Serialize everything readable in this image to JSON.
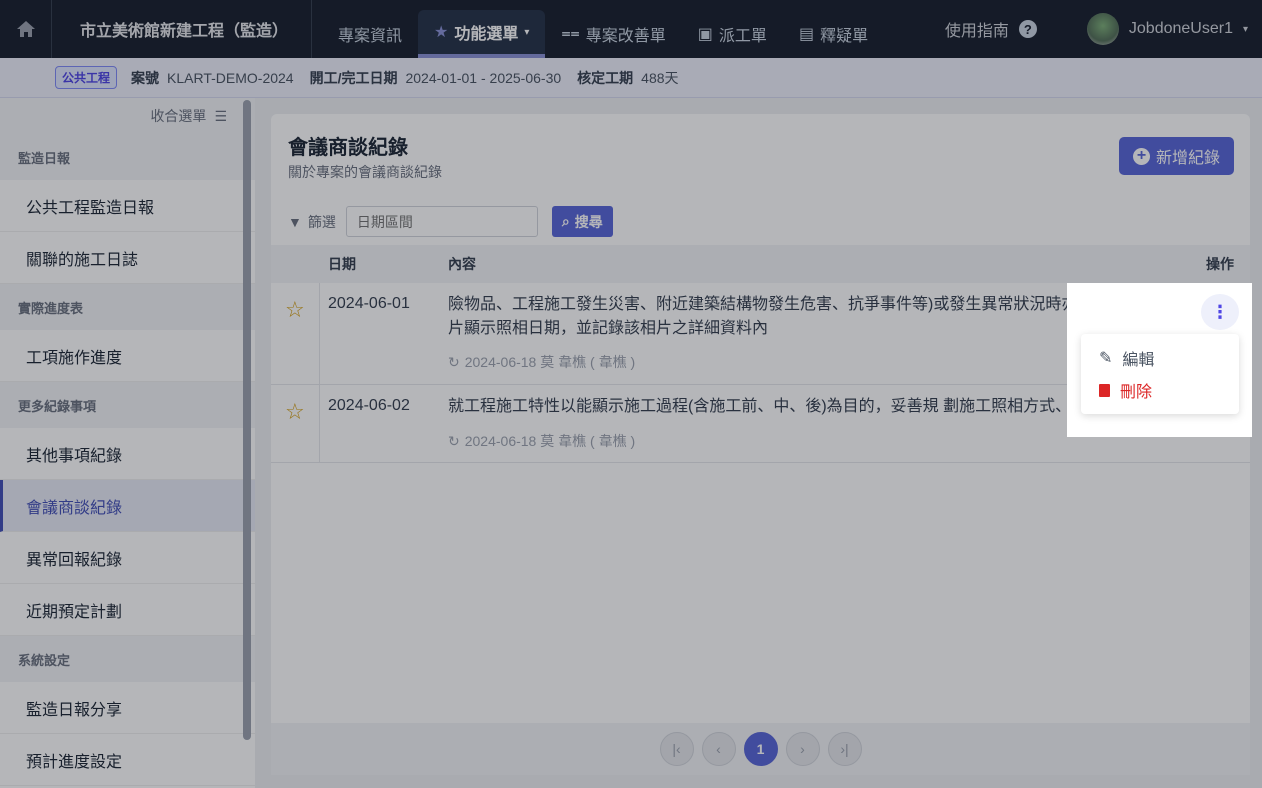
{
  "topnav": {
    "project": "市立美術館新建工程（監造）",
    "items": [
      "專案資訊",
      "功能選單",
      "專案改善單",
      "派工單",
      "釋疑單"
    ],
    "guide": "使用指南",
    "user": "JobdoneUser1"
  },
  "subbar": {
    "badge": "公共工程",
    "case_label": "案號",
    "case": "KLART-DEMO-2024",
    "dates_label": "開工/完工日期",
    "dates": "2024-01-01 - 2025-06-30",
    "period_label": "核定工期",
    "period": "488天"
  },
  "sidebar": {
    "collapse": "收合選單",
    "sections": [
      {
        "title": "監造日報",
        "items": [
          "公共工程監造日報",
          "關聯的施工日誌"
        ]
      },
      {
        "title": "實際進度表",
        "items": [
          "工項施作進度"
        ]
      },
      {
        "title": "更多紀錄事項",
        "items": [
          "其他事項紀錄",
          "會議商談紀錄",
          "異常回報紀錄",
          "近期預定計劃"
        ]
      },
      {
        "title": "系統設定",
        "items": [
          "監造日報分享",
          "預計進度設定"
        ]
      }
    ],
    "active": "會議商談紀錄"
  },
  "main": {
    "title": "會議商談紀錄",
    "subtitle": "關於專案的會議商談紀錄",
    "add": "新增紀錄",
    "filter": "篩選",
    "date_placeholder": "日期區間",
    "search": "搜尋",
    "columns": [
      "日期",
      "內容",
      "操作"
    ],
    "rows": [
      {
        "date": "2024-06-01",
        "content": "險物品、工程施工發生災害、附近建築結構物發生危害、抗爭事件等)或發生異常狀況時亦照相。所有照片顯示照相日期，並記錄該相片之詳細資料內",
        "meta": "2024-06-18 莫 韋樵 ( 韋樵 )"
      },
      {
        "date": "2024-06-02",
        "content": "就工程施工特性以能顯示施工過程(含施工前、中、後)為目的，妥善規 劃施工照相方式、位",
        "meta": "2024-06-18 莫 韋樵 ( 韋樵 )"
      }
    ],
    "menu": {
      "edit": "編輯",
      "delete": "刪除"
    },
    "page": "1"
  }
}
